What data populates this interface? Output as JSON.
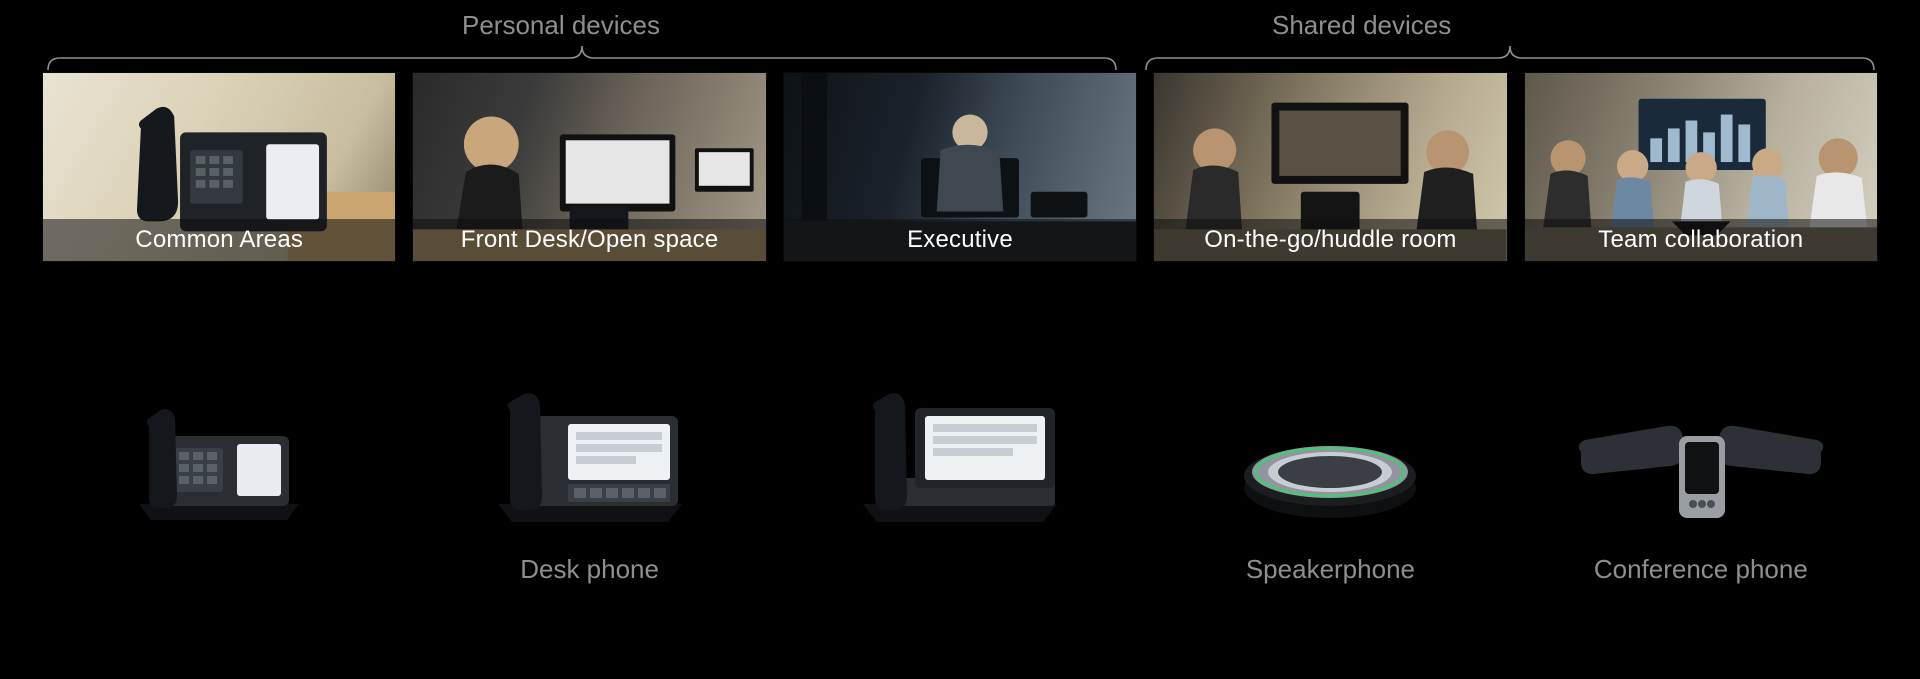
{
  "categories": {
    "personal": "Personal devices",
    "shared": "Shared devices"
  },
  "cards": [
    {
      "caption": "Common Areas"
    },
    {
      "caption": "Front Desk/Open space"
    },
    {
      "caption": "Executive"
    },
    {
      "caption": "On-the-go/huddle room"
    },
    {
      "caption": "Team collaboration"
    }
  ],
  "devices": [
    {
      "label": "",
      "icon": "deskphone-small"
    },
    {
      "label": "Desk phone",
      "icon": "deskphone-touch"
    },
    {
      "label": "",
      "icon": "deskphone-tablet"
    },
    {
      "label": "Speakerphone",
      "icon": "speakerphone-puck"
    },
    {
      "label": "Conference phone",
      "icon": "conference-phone"
    }
  ]
}
